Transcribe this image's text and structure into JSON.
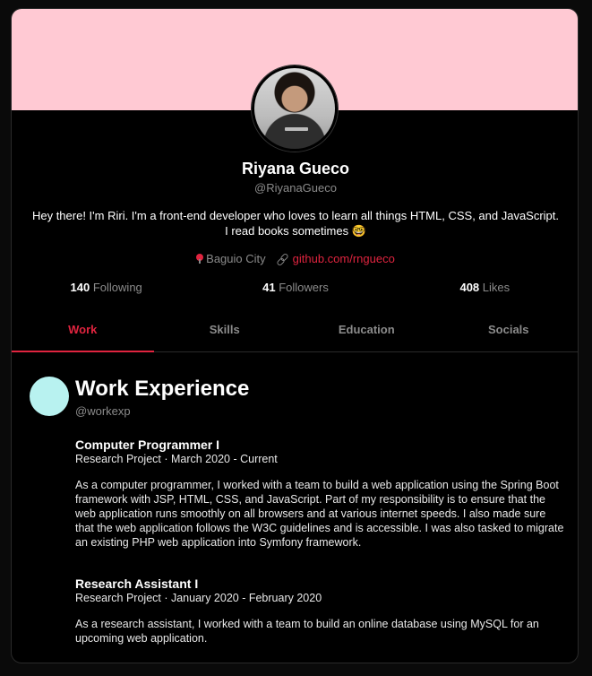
{
  "profile": {
    "name": "Riyana Gueco",
    "handle": "@RiyanaGueco",
    "bio_line1": "Hey there! I'm Riri. I'm a front-end developer who loves to learn all things HTML, CSS, and JavaScript.",
    "bio_line2": "I read books sometimes 🤓",
    "location": "Baguio City",
    "website": "github.com/rngueco"
  },
  "stats": [
    {
      "value": "140",
      "label": "Following"
    },
    {
      "value": "41",
      "label": "Followers"
    },
    {
      "value": "408",
      "label": "Likes"
    }
  ],
  "tabs": [
    {
      "label": "Work",
      "active": true
    },
    {
      "label": "Skills",
      "active": false
    },
    {
      "label": "Education",
      "active": false
    },
    {
      "label": "Socials",
      "active": false
    }
  ],
  "section": {
    "title": "Work Experience",
    "handle": "@workexp"
  },
  "jobs": [
    {
      "title": "Computer Programmer I",
      "sub": "Research Project · March 2020 - Current",
      "desc": "As a computer programmer, I worked with a team to build a web application using the Spring Boot framework with JSP, HTML, CSS, and JavaScript. Part of my responsibility is to ensure that the web application runs smoothly on all browsers and at various internet speeds. I also made sure that the web application follows the W3C guidelines and is accessible. I was also tasked to migrate an existing PHP web application into Symfony framework."
    },
    {
      "title": "Research Assistant I",
      "sub": "Research Project · January 2020 - February 2020",
      "desc": "As a research assistant, I worked with a team to build an online database using MySQL for an upcoming web application."
    }
  ],
  "colors": {
    "banner": "#ffc9d3",
    "accent": "#e0243f",
    "section_icon": "#b8f2f0",
    "background": "#000000"
  },
  "icons": {
    "location": "map-pin-icon",
    "website": "link-icon"
  }
}
